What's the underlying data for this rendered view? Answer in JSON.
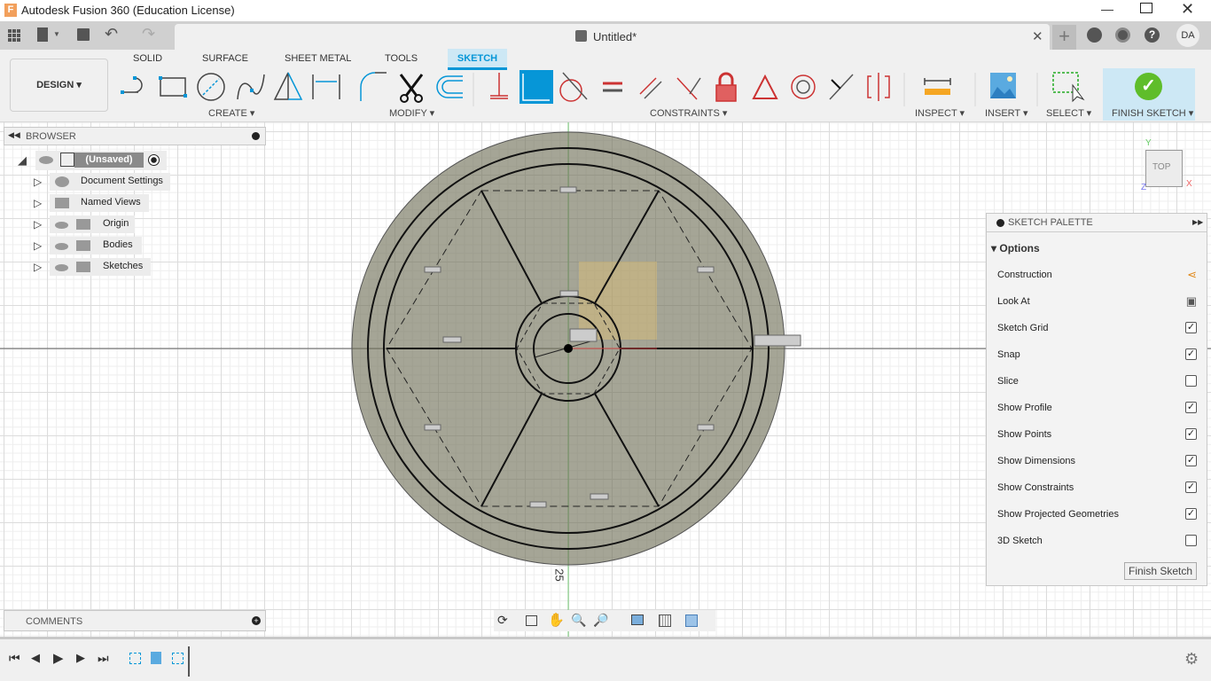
{
  "window": {
    "title": "Autodesk Fusion 360 (Education License)",
    "doc_tab": "Untitled*",
    "user_initials": "DA"
  },
  "ribbon": {
    "workspace": "DESIGN",
    "tabs": [
      {
        "label": "SOLID"
      },
      {
        "label": "SURFACE"
      },
      {
        "label": "SHEET METAL"
      },
      {
        "label": "TOOLS"
      },
      {
        "label": "SKETCH",
        "active": true
      }
    ],
    "groups": {
      "create": "CREATE",
      "modify": "MODIFY",
      "constraints": "CONSTRAINTS",
      "inspect": "INSPECT",
      "insert": "INSERT",
      "select": "SELECT",
      "finish": "FINISH SKETCH"
    },
    "accent": "#0696d7",
    "finish_bg": "#cde8f5"
  },
  "browser": {
    "title": "BROWSER",
    "root": "(Unsaved)",
    "items": [
      {
        "label": "Document Settings",
        "icon": "gear-icon"
      },
      {
        "label": "Named Views",
        "icon": "folder-icon"
      },
      {
        "label": "Origin",
        "icon": "folder-icon"
      },
      {
        "label": "Bodies",
        "icon": "folder-icon"
      },
      {
        "label": "Sketches",
        "icon": "folder-icon"
      }
    ]
  },
  "comments": {
    "title": "COMMENTS"
  },
  "viewcube": {
    "face": "TOP",
    "x": "X",
    "y": "Y",
    "z": "Z"
  },
  "canvas": {
    "dimension_label": "25"
  },
  "palette": {
    "title": "SKETCH PALETTE",
    "section": "Options",
    "options": [
      {
        "label": "Construction",
        "type": "icon"
      },
      {
        "label": "Look At",
        "type": "icon"
      },
      {
        "label": "Sketch Grid",
        "checked": true
      },
      {
        "label": "Snap",
        "checked": true
      },
      {
        "label": "Slice",
        "checked": false
      },
      {
        "label": "Show Profile",
        "checked": true
      },
      {
        "label": "Show Points",
        "checked": true
      },
      {
        "label": "Show Dimensions",
        "checked": true
      },
      {
        "label": "Show Constraints",
        "checked": true
      },
      {
        "label": "Show Projected Geometries",
        "checked": true
      },
      {
        "label": "3D Sketch",
        "checked": false
      }
    ],
    "finish_button": "Finish Sketch"
  }
}
